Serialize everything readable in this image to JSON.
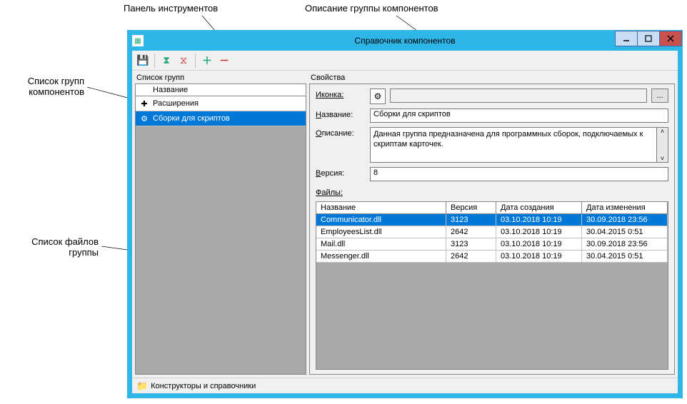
{
  "annotations": {
    "toolbar": "Панель инструментов",
    "group_desc": "Описание группы компонентов",
    "group_list": "Список групп компонентов",
    "file_list": "Список файлов группы"
  },
  "window": {
    "title": "Справочник компонентов"
  },
  "groups_panel": {
    "label": "Список групп",
    "header": "Название",
    "items": [
      {
        "icon": "puzzle",
        "label": "Расширения",
        "selected": false
      },
      {
        "icon": "gears",
        "label": "Сборки для скриптов",
        "selected": true
      }
    ]
  },
  "props_panel": {
    "label": "Свойства",
    "icon_label": "Иконка:",
    "name_label": "Название:",
    "desc_label": "Описание:",
    "version_label": "Версия:",
    "files_label": "Файлы:",
    "browse": "...",
    "name_value": "Сборки для скриптов",
    "desc_value": "Данная группа предназначена для программных сборок, подключаемых к скриптам карточек.",
    "version_value": "8"
  },
  "files_table": {
    "columns": {
      "name": "Название",
      "version": "Версия",
      "created": "Дата создания",
      "modified": "Дата изменения"
    },
    "rows": [
      {
        "name": "Communicator.dll",
        "version": "3123",
        "created": "03.10.2018 10:19",
        "modified": "30.09.2018 23:56",
        "selected": true
      },
      {
        "name": "EmployeesList.dll",
        "version": "2642",
        "created": "03.10.2018 10:19",
        "modified": "30.04.2015 0:51",
        "selected": false
      },
      {
        "name": "Mail.dll",
        "version": "3123",
        "created": "03.10.2018 10:19",
        "modified": "30.09.2018 23:56",
        "selected": false
      },
      {
        "name": "Messenger.dll",
        "version": "2642",
        "created": "03.10.2018 10:19",
        "modified": "30.04.2015 0:51",
        "selected": false
      }
    ]
  },
  "statusbar": {
    "text": "Конструкторы и справочники"
  },
  "icons": {
    "puzzle": "✚",
    "gears": "⚙",
    "save": "💾",
    "folder": "📁",
    "scroll_up": "˄",
    "scroll_down": "˅"
  }
}
